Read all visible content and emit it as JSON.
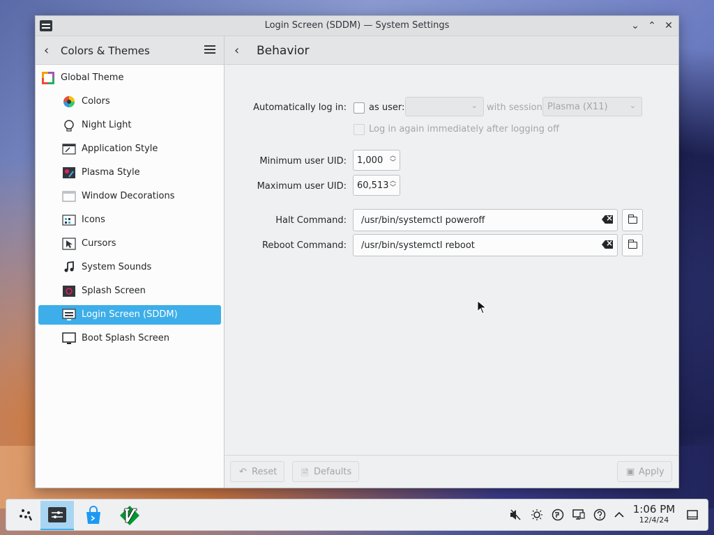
{
  "window": {
    "title": "Login Screen (SDDM) — System Settings",
    "controls": {
      "minimize": "⌄",
      "maximize": "⌃",
      "close": "✕"
    }
  },
  "sidebar": {
    "back_label": "Colors & Themes",
    "items": [
      {
        "label": "Global Theme",
        "icon": "global-theme-icon"
      },
      {
        "label": "Colors",
        "icon": "colors-icon"
      },
      {
        "label": "Night Light",
        "icon": "night-light-icon"
      },
      {
        "label": "Application Style",
        "icon": "application-style-icon"
      },
      {
        "label": "Plasma Style",
        "icon": "plasma-style-icon"
      },
      {
        "label": "Window Decorations",
        "icon": "window-decorations-icon"
      },
      {
        "label": "Icons",
        "icon": "icons-icon"
      },
      {
        "label": "Cursors",
        "icon": "cursors-icon"
      },
      {
        "label": "System Sounds",
        "icon": "system-sounds-icon"
      },
      {
        "label": "Splash Screen",
        "icon": "splash-screen-icon"
      },
      {
        "label": "Login Screen (SDDM)",
        "icon": "login-screen-icon",
        "selected": true
      },
      {
        "label": "Boot Splash Screen",
        "icon": "boot-splash-icon"
      }
    ]
  },
  "page": {
    "title": "Behavior",
    "autologin": {
      "label": "Automatically log in:",
      "as_user_label": "as user:",
      "user_value": "",
      "with_session_label": "with session",
      "session_value": "Plasma (X11)",
      "relogin_label": "Log in again immediately after logging off"
    },
    "min_uid": {
      "label": "Minimum user UID:",
      "value": "1,000"
    },
    "max_uid": {
      "label": "Maximum user UID:",
      "value": "60,513"
    },
    "halt": {
      "label": "Halt Command:",
      "value": "/usr/bin/systemctl poweroff"
    },
    "reboot": {
      "label": "Reboot Command:",
      "value": "/usr/bin/systemctl reboot"
    }
  },
  "footer": {
    "reset": "Reset",
    "defaults": "Defaults",
    "apply": "Apply"
  },
  "taskbar": {
    "time": "1:06 PM",
    "date": "12/4/24",
    "tray_icons": [
      "audio-muted-icon",
      "brightness-icon",
      "network-icon",
      "display-icon",
      "help-icon",
      "expand-tray-icon"
    ]
  }
}
